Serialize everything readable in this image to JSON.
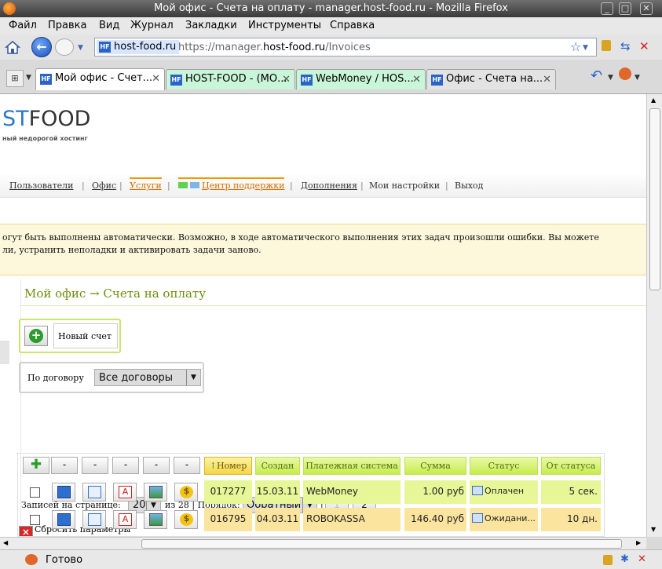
{
  "window": {
    "title": "Мой офис - Счета на оплату - manager.host-food.ru - Mozilla Firefox"
  },
  "menubar": [
    "Файл",
    "Правка",
    "Вид",
    "Журнал",
    "Закладки",
    "Инструменты",
    "Справка"
  ],
  "urlbar": {
    "site": "host-food.ru",
    "url_prefix": "https://manager.",
    "url_domain": "host-food.ru",
    "url_path": "/Invoices",
    "site_badge": "HF"
  },
  "tabs": [
    {
      "label": "Мой офис - Счет...",
      "active": true
    },
    {
      "label": "HOST-FOOD - (МО...",
      "active": false
    },
    {
      "label": "WebMoney / HOS...",
      "active": false
    },
    {
      "label": "Офис - Счета на...",
      "active": false
    }
  ],
  "site": {
    "logo_part1": "ST",
    "logo_part2": "FOOD",
    "tagline": "ный недорогой хостинг",
    "nav": [
      "Пользователи",
      "Офис",
      "Услуги",
      "Центр поддержки",
      "Дополнения",
      "Мои настройки",
      "Выход"
    ],
    "notice_line1": "огут быть выполнены автоматически. Возможно, в ходе автоматического выполнения этих задач произошли ошибки. Вы можете",
    "notice_line2": "ли, устранить неполадки и активировать задачи заново."
  },
  "main": {
    "title": "Мой офис → Счета на оплату",
    "new_invoice": "Новый счет",
    "filter_label": "По договору",
    "filter_value": "Все договоры",
    "per_page_label": "Записей на странице:",
    "per_page_value": "20",
    "of_total": "из 28 | Порядок:",
    "order_value": "Обратный",
    "page_sep": "|",
    "pages": [
      "1",
      "2"
    ],
    "reset": "Сбросить параметры"
  },
  "grid": {
    "action_headers": [
      "-",
      "-",
      "-",
      "-",
      "-"
    ],
    "columns": [
      "Номер",
      "Создан",
      "Платежная система",
      "Сумма",
      "Статус",
      "От статуса"
    ],
    "rows": [
      {
        "number": "017277",
        "created": "15.03.11",
        "system": "WebMoney",
        "amount": "1.00 руб",
        "status": "Оплачен",
        "since": "5 сек."
      },
      {
        "number": "016795",
        "created": "04.03.11",
        "system": "ROBOKASSA",
        "amount": "146.40 руб",
        "status": "Ожидани...",
        "since": "10 дн."
      }
    ]
  },
  "status": {
    "text": "Готово"
  },
  "colors": {
    "accent_green": "#c7ec4d",
    "title_green": "#6c8f0d",
    "orange": "#d36f00",
    "row_paid": "#e7f797",
    "row_wait": "#fbe59e"
  }
}
